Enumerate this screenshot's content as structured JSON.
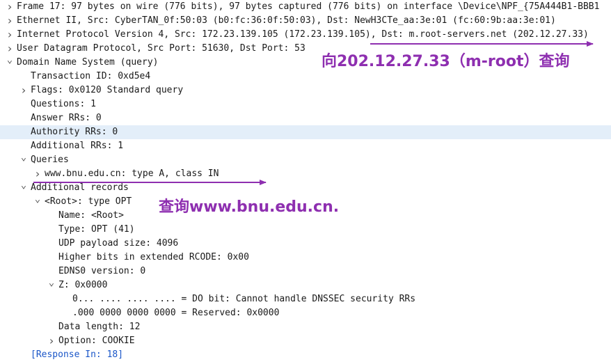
{
  "tree": [
    {
      "level": 0,
      "toggle": "collapsed",
      "text": "Frame 17: 97 bytes on wire (776 bits), 97 bytes captured (776 bits) on interface \\Device\\NPF_{75A444B1-BBB1"
    },
    {
      "level": 0,
      "toggle": "collapsed",
      "text": "Ethernet II, Src: CyberTAN_0f:50:03 (b0:fc:36:0f:50:03), Dst: NewH3CTe_aa:3e:01 (fc:60:9b:aa:3e:01)"
    },
    {
      "level": 0,
      "toggle": "collapsed",
      "text": "Internet Protocol Version 4, Src: 172.23.139.105 (172.23.139.105), Dst: m.root-servers.net (202.12.27.33)"
    },
    {
      "level": 0,
      "toggle": "collapsed",
      "text": "User Datagram Protocol, Src Port: 51630, Dst Port: 53"
    },
    {
      "level": 0,
      "toggle": "expanded",
      "text": "Domain Name System (query)"
    },
    {
      "level": 1,
      "toggle": "none",
      "text": "Transaction ID: 0xd5e4"
    },
    {
      "level": 1,
      "toggle": "collapsed",
      "text": "Flags: 0x0120 Standard query"
    },
    {
      "level": 1,
      "toggle": "none",
      "text": "Questions: 1"
    },
    {
      "level": 1,
      "toggle": "none",
      "text": "Answer RRs: 0"
    },
    {
      "level": 1,
      "toggle": "none",
      "text": "Authority RRs: 0",
      "selected": true
    },
    {
      "level": 1,
      "toggle": "none",
      "text": "Additional RRs: 1"
    },
    {
      "level": 1,
      "toggle": "expanded",
      "text": "Queries"
    },
    {
      "level": 2,
      "toggle": "collapsed",
      "text": "www.bnu.edu.cn: type A, class IN"
    },
    {
      "level": 1,
      "toggle": "expanded",
      "text": "Additional records"
    },
    {
      "level": 2,
      "toggle": "expanded",
      "text": "<Root>: type OPT"
    },
    {
      "level": 3,
      "toggle": "none",
      "text": "Name: <Root>"
    },
    {
      "level": 3,
      "toggle": "none",
      "text": "Type: OPT (41)"
    },
    {
      "level": 3,
      "toggle": "none",
      "text": "UDP payload size: 4096"
    },
    {
      "level": 3,
      "toggle": "none",
      "text": "Higher bits in extended RCODE: 0x00"
    },
    {
      "level": 3,
      "toggle": "none",
      "text": "EDNS0 version: 0"
    },
    {
      "level": 3,
      "toggle": "expanded",
      "text": "Z: 0x0000"
    },
    {
      "level": 4,
      "toggle": "none",
      "text": "0... .... .... .... = DO bit: Cannot handle DNSSEC security RRs"
    },
    {
      "level": 4,
      "toggle": "none",
      "text": ".000 0000 0000 0000 = Reserved: 0x0000"
    },
    {
      "level": 3,
      "toggle": "none",
      "text": "Data length: 12"
    },
    {
      "level": 3,
      "toggle": "collapsed",
      "text": "Option: COOKIE"
    },
    {
      "level": 1,
      "toggle": "none",
      "text": "[Response In: 18]",
      "link": true
    }
  ],
  "annotations": {
    "server_note": "向202.12.27.33（m-root）查询",
    "query_note": "查询www.bnu.edu.cn.",
    "color": "#8e2fb0"
  },
  "colors": {
    "selected_row": "#e3eef9",
    "link": "#1a56c8"
  }
}
